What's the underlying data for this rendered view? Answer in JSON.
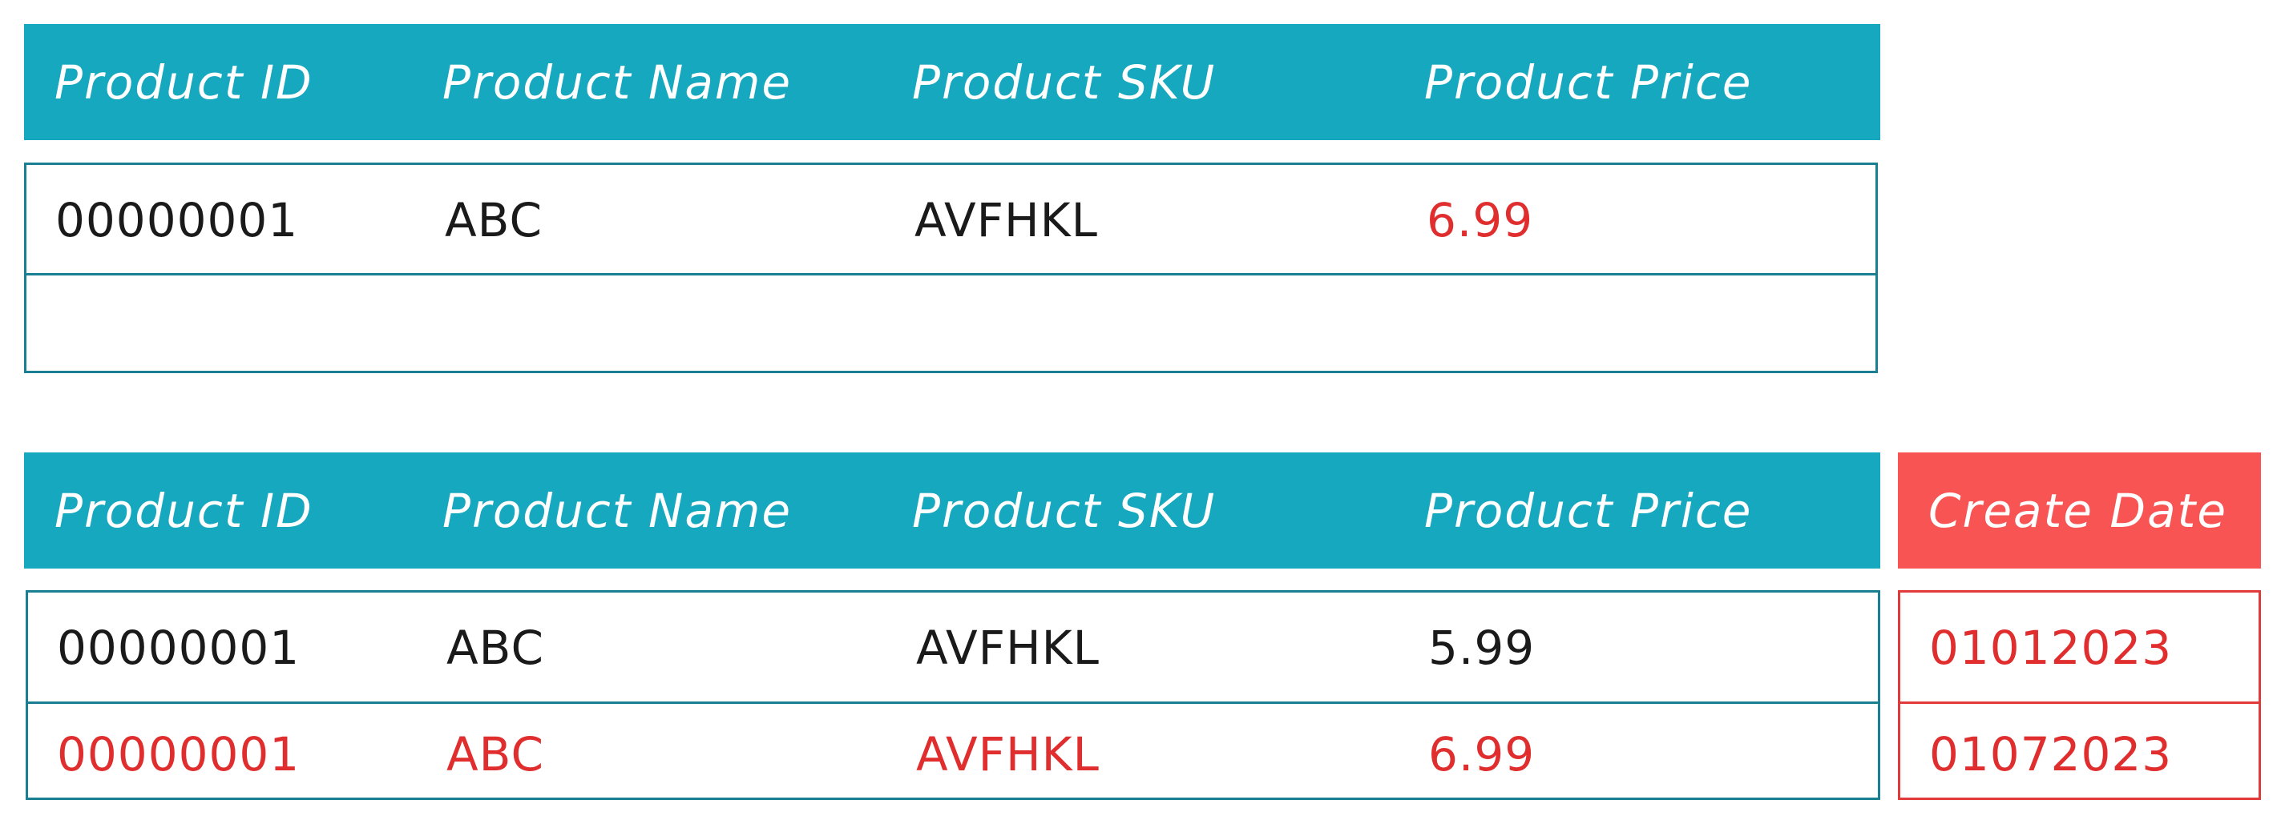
{
  "table1": {
    "headers": [
      "Product ID",
      "Product Name",
      "Product SKU",
      "Product Price"
    ],
    "rows": [
      {
        "id": "00000001",
        "name": "ABC",
        "sku": "AVFHKL",
        "price": "6.99"
      }
    ]
  },
  "table2": {
    "headers": [
      "Product ID",
      "Product Name",
      "Product SKU",
      "Product Price"
    ],
    "extra_header": "Create Date",
    "rows": [
      {
        "id": "00000001",
        "name": "ABC",
        "sku": "AVFHKL",
        "price": "5.99",
        "date": "01012023"
      },
      {
        "id": "00000001",
        "name": "ABC",
        "sku": "AVFHKL",
        "price": "6.99",
        "date": "01072023"
      }
    ]
  },
  "colors": {
    "header": "#16a8bf",
    "header_new_column": "#f95454",
    "border": "#1a7f92",
    "highlight_text": "#e02e2e"
  }
}
